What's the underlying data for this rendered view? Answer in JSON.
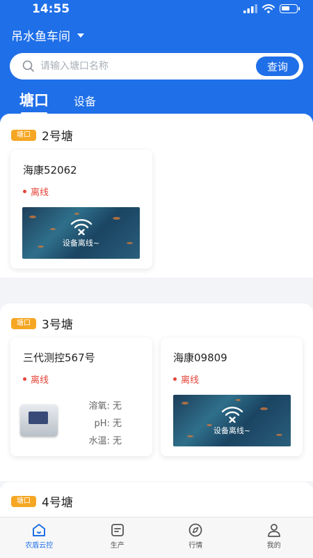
{
  "status_bar": {
    "time": "14:55",
    "battery_level": 0.6
  },
  "header": {
    "location": "吊水鱼车间",
    "search": {
      "placeholder": "请输入塘口名称",
      "button_label": "查询"
    },
    "tabs": [
      {
        "label": "塘口",
        "active": true
      },
      {
        "label": "设备",
        "active": false
      }
    ]
  },
  "colors": {
    "primary": "#1f6fe8",
    "offline": "#e5453a",
    "tag": "#f5a623"
  },
  "ponds": [
    {
      "tag": "塘口",
      "name": "2号塘",
      "devices": [
        {
          "name": "海康52062",
          "status": "离线",
          "type": "camera",
          "overlay_text": "设备离线~"
        }
      ]
    },
    {
      "tag": "塘口",
      "name": "3号塘",
      "devices": [
        {
          "name": "三代测控567号",
          "status": "离线",
          "type": "sensor",
          "metrics": [
            {
              "label": "溶氧",
              "value": "无"
            },
            {
              "label": "pH",
              "value": "无"
            },
            {
              "label": "水温",
              "value": "无"
            }
          ]
        },
        {
          "name": "海康09809",
          "status": "离线",
          "type": "camera",
          "overlay_text": "设备离线~"
        }
      ]
    },
    {
      "tag": "塘口",
      "name": "4号塘",
      "devices": []
    }
  ],
  "bottom_nav": [
    {
      "label": "农盾云控",
      "icon": "home-icon",
      "active": true
    },
    {
      "label": "生产",
      "icon": "clipboard-icon",
      "active": false
    },
    {
      "label": "行情",
      "icon": "compass-icon",
      "active": false
    },
    {
      "label": "我的",
      "icon": "user-icon",
      "active": false
    }
  ]
}
